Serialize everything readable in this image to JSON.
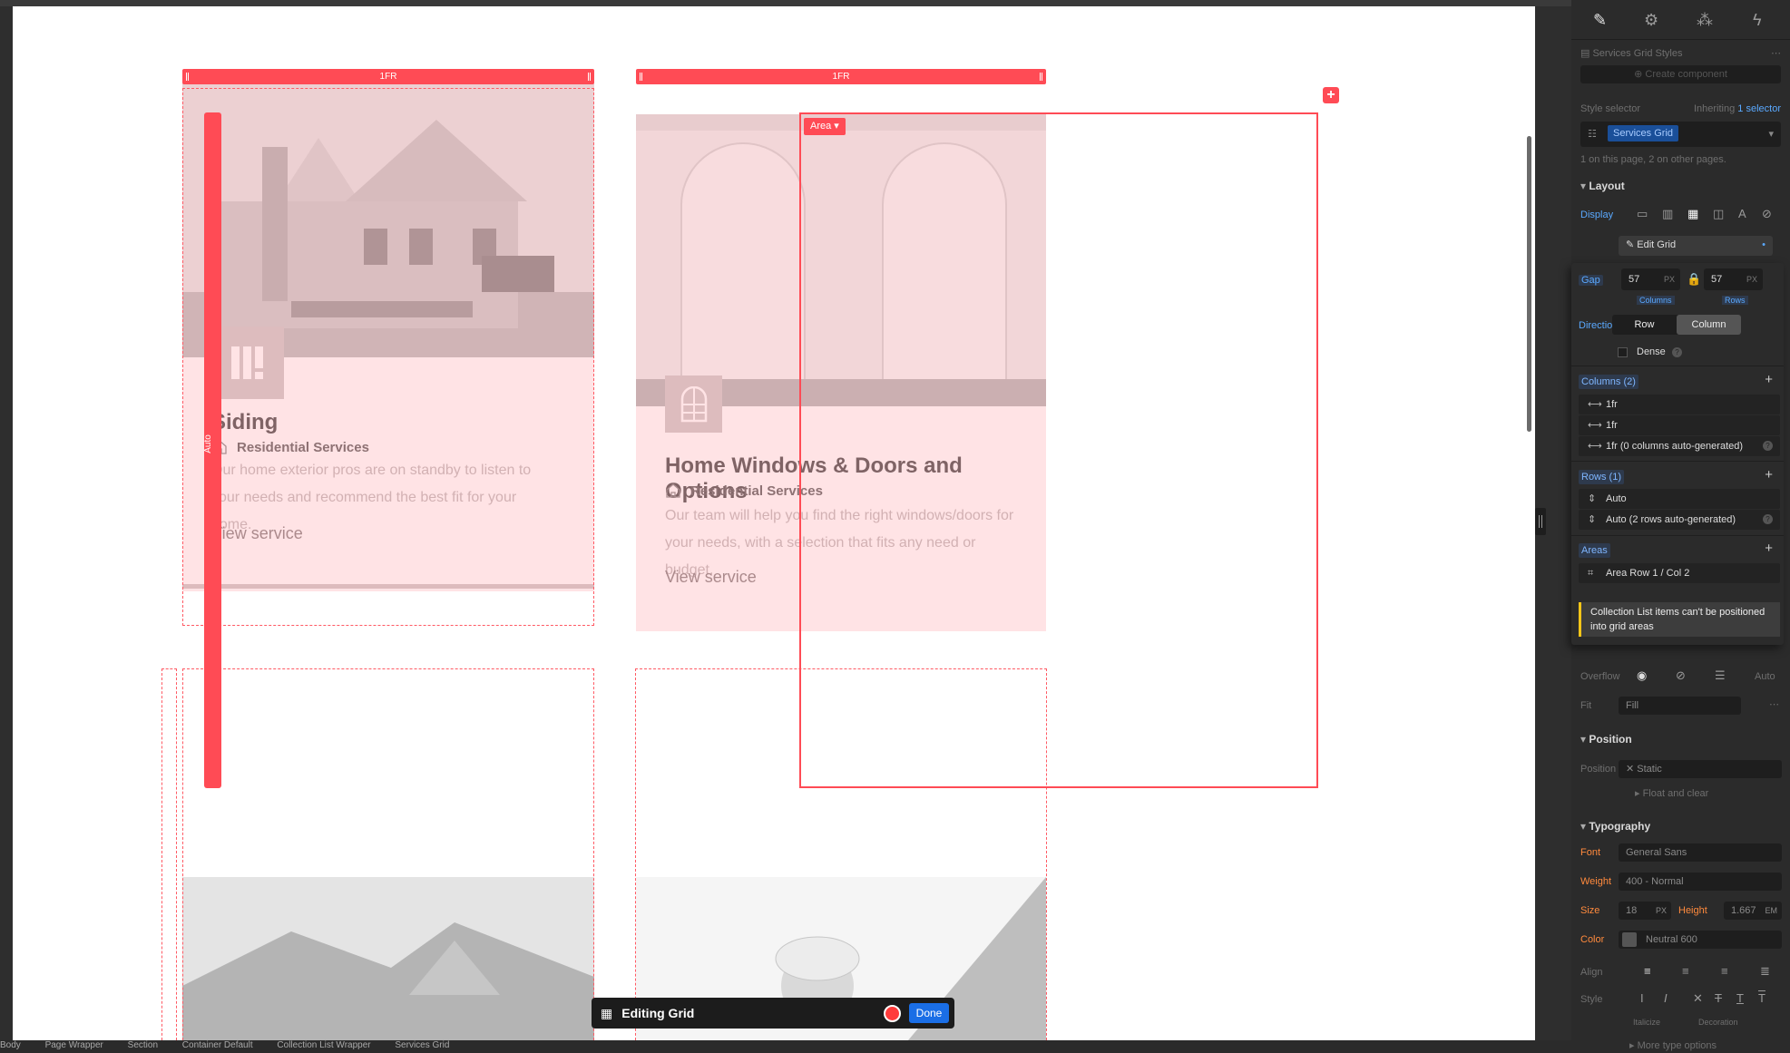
{
  "canvas": {
    "columns": [
      "1FR",
      "1FR"
    ],
    "row_label": "Auto",
    "area_chip": "Area ▾",
    "cards": [
      {
        "title": "Siding",
        "subtitle": "Residential Services",
        "description": "Our home exterior pros are on standby to listen to your needs and recommend the best fit for your home.",
        "link": "View service"
      },
      {
        "title": "Home Windows & Doors and Options",
        "subtitle": "Residential Services",
        "description": "Our team will help you find the right windows/doors for your needs, with a selection that fits any need or budget.",
        "link": "View service"
      }
    ]
  },
  "toolbar": {
    "title": "Editing Grid",
    "done_label": "Done"
  },
  "breadcrumbs": [
    "Body",
    "Page Wrapper",
    "Section",
    "Container Default",
    "Collection List Wrapper",
    "Services Grid"
  ],
  "panel": {
    "component_title": "Services Grid Styles",
    "create_component": "Create component",
    "style_selector_label": "Style selector",
    "inheriting_prefix": "Inheriting",
    "inheriting_link": "1 selector",
    "selector_chip": "Services Grid",
    "selector_note": "1 on this page, 2 on other pages.",
    "layout_section": "Layout",
    "display_label": "Display",
    "edit_grid_label": "Edit Grid",
    "overflow_label": "Overflow",
    "overflow_auto": "Auto",
    "fit_label": "Fit",
    "fit_value": "Fill",
    "position_section": "Position",
    "position_label": "Position",
    "position_value": "Static",
    "float_clear": "Float and clear",
    "typography_section": "Typography",
    "font_label": "Font",
    "font_value": "General Sans",
    "weight_label": "Weight",
    "weight_value": "400 - Normal",
    "size_label": "Size",
    "size_value": "18",
    "size_unit": "PX",
    "height_label": "Height",
    "height_value": "1.667",
    "height_unit": "EM",
    "color_label": "Color",
    "color_value": "Neutral 600",
    "align_label": "Align",
    "style_label": "Style",
    "italicize_label": "Italicize",
    "decoration_label": "Decoration",
    "more_type": "More type options"
  },
  "grid_popover": {
    "gap_label": "Gap",
    "gap_columns": "57",
    "gap_rows": "57",
    "gap_unit": "PX",
    "columns_caption": "Columns",
    "rows_caption": "Rows",
    "direction_label": "Direction",
    "direction_row": "Row",
    "direction_column": "Column",
    "dense_label": "Dense",
    "columns_header": "Columns (2)",
    "columns": [
      "1fr",
      "1fr",
      "1fr (0 columns auto-generated)"
    ],
    "rows_header": "Rows (1)",
    "rows": [
      "Auto",
      "Auto (2 rows auto-generated)"
    ],
    "areas_header": "Areas",
    "areas": [
      "Area Row 1 / Col 2"
    ],
    "warning": "Collection List items can't be positioned into grid areas"
  },
  "colors": {
    "grid_red": "#ff4b55",
    "accent_blue": "#1a6ee6",
    "panel_bg": "#2b2b2b"
  }
}
